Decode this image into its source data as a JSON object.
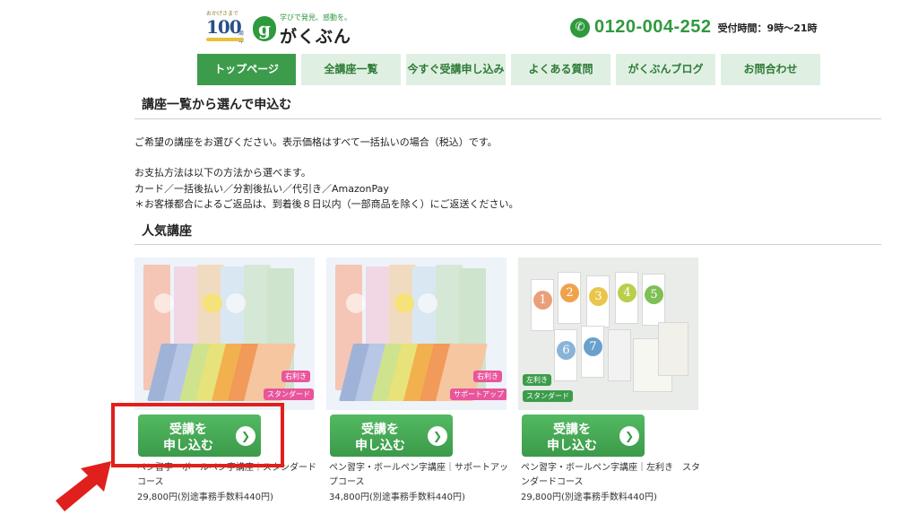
{
  "header": {
    "anniversary_top": "おかげさまで",
    "anniversary_number": "100",
    "anniversary_suffix": "周年",
    "logo_mark": "g",
    "logo_tagline": "学びで発見、感動を。",
    "logo_name": "がくぶん",
    "phone_number": "0120-004-252",
    "phone_hours": "受付時間：9時〜21時"
  },
  "nav": [
    {
      "label": "トップページ"
    },
    {
      "label": "全講座一覧"
    },
    {
      "label": "今すぐ受講申し込み"
    },
    {
      "label": "よくある質問"
    },
    {
      "label": "がくぶんブログ"
    },
    {
      "label": "お問合わせ"
    }
  ],
  "main": {
    "title": "講座一覧から選んで申込む",
    "intro": "ご希望の講座をお選びください。表示価格はすべて一括払いの場合（税込）です。",
    "payment_heading": "お支払方法は以下の方法から選べます。",
    "payment_methods": "カード／一括後払い／分割後払い／代引き／AmazonPay",
    "return_note": "＊お客様都合によるご返品は、到着後８日以内（一部商品を除く）にご返送ください。",
    "popular_title": "人気講座"
  },
  "products": [
    {
      "tag_top": "右利き",
      "tag_bottom": "スタンダード",
      "button_line1": "受講を",
      "button_line2": "申し込む",
      "name": "ペン習字・ボールペン字講座｜スタンダードコース",
      "price": "29,800円(別途事務手数料440円)"
    },
    {
      "tag_top": "右利き",
      "tag_bottom": "サポートアップ",
      "button_line1": "受講を",
      "button_line2": "申し込む",
      "name": "ペン習字・ボールペン字講座｜サポートアップコース",
      "price": "34,800円(別途事務手数料440円)"
    },
    {
      "tag_top": "左利き",
      "tag_bottom": "スタンダード",
      "button_line1": "受講を",
      "button_line2": "申し込む",
      "name": "ペン習字・ボールペン字講座｜左利き　スタンダードコース",
      "price": "29,800円(別途事務手数料440円)"
    }
  ],
  "colors": {
    "brand_green": "#3c9c4b",
    "nav_inactive_bg": "#dff0e2",
    "tag_pink": "#e9559b",
    "highlight_red": "#e0201c"
  },
  "icons": {
    "phone": "phone-icon",
    "button_arrow": "chevron-right-circle-icon",
    "annotation_arrow": "red-arrow-icon"
  }
}
